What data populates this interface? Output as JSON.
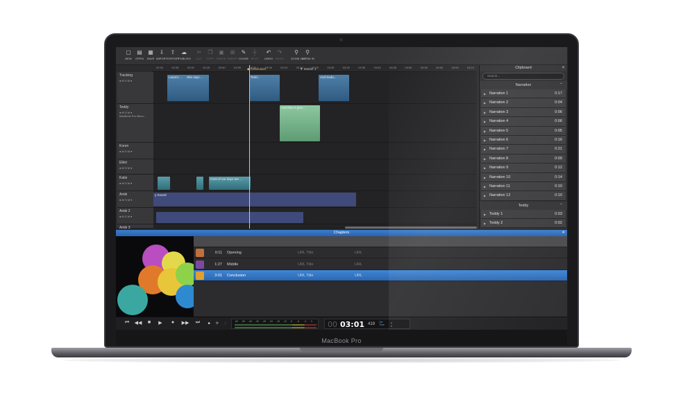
{
  "device": {
    "brand": "MacBook Pro"
  },
  "toolbar": {
    "buttons": [
      {
        "label": "NEW",
        "icon": "new-file-icon",
        "glyph": "▢",
        "enabled": true
      },
      {
        "label": "OPEN",
        "icon": "open-icon",
        "glyph": "▤",
        "enabled": true
      },
      {
        "label": "SAVE",
        "icon": "save-icon",
        "glyph": "▦",
        "enabled": true
      },
      {
        "label": "IMPORT",
        "icon": "import-icon",
        "glyph": "⇩",
        "enabled": true
      },
      {
        "label": "EXPORT",
        "icon": "export-icon",
        "glyph": "⇧",
        "enabled": true
      },
      {
        "label": "PUBLISH",
        "icon": "publish-icon",
        "glyph": "☁",
        "enabled": true
      },
      {
        "label": "CUT",
        "icon": "cut-icon",
        "glyph": "✂",
        "enabled": false
      },
      {
        "label": "COPY",
        "icon": "copy-icon",
        "glyph": "❐",
        "enabled": false
      },
      {
        "label": "PASTE",
        "icon": "paste-icon",
        "glyph": "▣",
        "enabled": false
      },
      {
        "label": "INSERT",
        "icon": "insert-icon",
        "glyph": "⊞",
        "enabled": false
      },
      {
        "label": "CLEAR",
        "icon": "clear-icon",
        "glyph": "✎",
        "enabled": true
      },
      {
        "label": "SPLIT",
        "icon": "split-icon",
        "glyph": "┼",
        "enabled": false
      },
      {
        "label": "UNDO",
        "icon": "undo-icon",
        "glyph": "↶",
        "enabled": true
      },
      {
        "label": "REDO",
        "icon": "redo-icon",
        "glyph": "↷",
        "enabled": false
      },
      {
        "label": "ZOOM OUT",
        "icon": "zoom-out-icon",
        "glyph": "⚲",
        "enabled": true
      },
      {
        "label": "ZOOM IN",
        "icon": "zoom-in-icon",
        "glyph": "⚲",
        "enabled": true
      }
    ]
  },
  "ruler": {
    "ticks": [
      "02:30",
      "02:35",
      "02:40",
      "02:45",
      "02:50",
      "02:55",
      "03:00",
      "03:05",
      "03:10",
      "03:15",
      "03:20",
      "03:25",
      "03:30",
      "03:35",
      "03:40",
      "03:45",
      "03:50",
      "03:55",
      "04:00",
      "04:05",
      "04:10"
    ]
  },
  "markers": [
    {
      "label": "Conclusion"
    },
    {
      "label": "Marker 1"
    }
  ],
  "tracks": [
    {
      "name": "Tracking",
      "controls": "● M S M ▾"
    },
    {
      "name": "Teddy",
      "controls": "● M S M ▾",
      "device": "MacBook Pro Micro..."
    },
    {
      "name": "Koren",
      "controls": "● M S M ▾"
    },
    {
      "name": "Elliot",
      "controls": "● M S M ▾"
    },
    {
      "name": "Katie",
      "controls": "● M S M ▾"
    },
    {
      "name": "Ambi",
      "controls": "● M S M ▾"
    },
    {
      "name": "Ambi 2",
      "controls": "● M S M ▾"
    },
    {
      "name": "Ambi 3",
      "controls": ""
    }
  ],
  "clips": {
    "tracking": [
      "Laura's ...",
      "She says ...",
      "Tedd...",
      "And Seda..."
    ],
    "teddy": [
      "T...",
      "And then it give..."
    ],
    "katie": [
      "most of our days are ..."
    ],
    "ambi": [
      "y Sound"
    ]
  },
  "clipboard": {
    "title": "Clipboard",
    "search_placeholder": "Search...",
    "sections": [
      {
        "title": "Narration",
        "items": [
          {
            "name": "Narration 1",
            "duration": "0:17"
          },
          {
            "name": "Narration 2",
            "duration": "0:04"
          },
          {
            "name": "Narration 3",
            "duration": "0:06"
          },
          {
            "name": "Narration 4",
            "duration": "0:06"
          },
          {
            "name": "Narration 5",
            "duration": "0:05"
          },
          {
            "name": "Narration 6",
            "duration": "0:16"
          },
          {
            "name": "Narration 7",
            "duration": "0:21"
          },
          {
            "name": "Narration 8",
            "duration": "0:09"
          },
          {
            "name": "Narration 9",
            "duration": "0:12"
          },
          {
            "name": "Narration 10",
            "duration": "0:14"
          },
          {
            "name": "Narration 11",
            "duration": "0:10"
          },
          {
            "name": "Narration 12",
            "duration": "0:10"
          }
        ]
      },
      {
        "title": "Teddy",
        "items": [
          {
            "name": "Teddy 1",
            "duration": "0:03"
          },
          {
            "name": "Teddy 2",
            "duration": "0:02"
          }
        ]
      }
    ]
  },
  "chapters": {
    "title": "Chapters",
    "rows": [
      {
        "time": "0:11",
        "title": "Opening",
        "field_url": "URL Title",
        "field_extra": "URL",
        "thumb_color": "#c0703a"
      },
      {
        "time": "1:27",
        "title": "Middle",
        "field_url": "URL Title",
        "field_extra": "URL",
        "thumb_color": "#7a4aa0"
      },
      {
        "time": "3:01",
        "title": "Conclusion",
        "field_url": "URL Title",
        "field_extra": "URL",
        "thumb_color": "#e0a030"
      }
    ],
    "selected_index": 2
  },
  "transport": {
    "buttons": [
      {
        "name": "skip-to-start",
        "glyph": "⏮"
      },
      {
        "name": "rewind",
        "glyph": "◀◀"
      },
      {
        "name": "stop",
        "glyph": "■"
      },
      {
        "name": "play",
        "glyph": "▶"
      },
      {
        "name": "record",
        "glyph": "●"
      },
      {
        "name": "fast-forward",
        "glyph": "▶▶"
      },
      {
        "name": "skip-to-end",
        "glyph": "⏭"
      }
    ],
    "meter_labels": [
      "-60",
      "-50",
      "-40",
      "-30",
      "-25",
      "-20",
      "-15",
      "-12",
      "-9",
      "-6",
      "-3",
      "0"
    ],
    "clock": {
      "hours": "00",
      "minutes": "03:01",
      "frames": "419",
      "overdub": "Ovr\nTime"
    }
  },
  "colors": {
    "accent": "#2f74c8",
    "clip_blue": "#4e7fa8",
    "clip_green": "#8dc7a1"
  }
}
